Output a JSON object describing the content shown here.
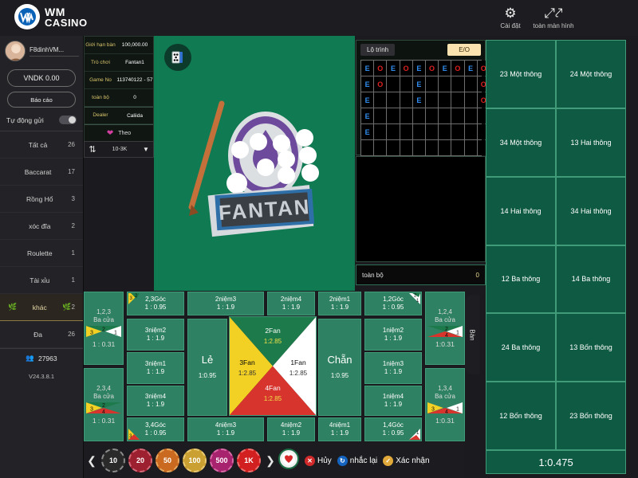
{
  "header": {
    "brand_line1": "WM",
    "brand_line2": "CASINO",
    "settings_label": "Cài đặt",
    "settings_icon": "gear-icon",
    "fullscreen_label": "toàn màn hình",
    "fullscreen_icon": "expand-icon"
  },
  "sidebar": {
    "username": "F8dinhVM...",
    "balance": "VNDK 0.00",
    "report_label": "Báo cáo",
    "auto_send_label": "Tự động gửi",
    "items": [
      {
        "label": "Tất cả",
        "count": "26"
      },
      {
        "label": "Baccarat",
        "count": "17"
      },
      {
        "label": "Rồng Hổ",
        "count": "3"
      },
      {
        "label": "xóc đĩa",
        "count": "2"
      },
      {
        "label": "Roulette",
        "count": "1"
      },
      {
        "label": "Tài xỉu",
        "count": "1"
      },
      {
        "label": "khác",
        "count": "2"
      },
      {
        "label": "Đa",
        "count": "26"
      }
    ],
    "online_count": "27963",
    "version": "V24.3.8.1"
  },
  "info": {
    "rows": [
      {
        "key": "Giới hạn bàn",
        "value": "100,000.00"
      },
      {
        "key": "Trò chơi",
        "value": "Fantan1"
      },
      {
        "key": "Game No",
        "value": "113740122 - 57"
      },
      {
        "key": "toàn bộ",
        "value": "0"
      },
      {
        "key": "Dealer",
        "value": "Caliida"
      }
    ],
    "follow_label": "Theo",
    "heart_icon": "heart-icon"
  },
  "range": {
    "icon": "sort-filter-icon",
    "value": "10-3K",
    "arrow_icon": "chevron-down-icon"
  },
  "video": {
    "card_icon": "playing-card-icon",
    "game_logo": "FANTAN"
  },
  "roadmap": {
    "tab_label": "Lộ trình",
    "eo_label": "E/O",
    "columns": 10,
    "rows": 6,
    "cells": [
      [
        "E",
        "O",
        "E",
        "O",
        "E",
        "O",
        "E",
        "O",
        "E",
        "O"
      ],
      [
        "E",
        "O",
        "",
        "",
        "E",
        "",
        "",
        "",
        "",
        "O"
      ],
      [
        "E",
        "",
        "",
        "",
        "E",
        "",
        "",
        "",
        "",
        "O"
      ],
      [
        "E",
        "",
        "",
        "",
        "",
        "",
        "",
        "",
        "",
        ""
      ],
      [
        "E",
        "",
        "",
        "",
        "",
        "",
        "",
        "",
        "",
        ""
      ],
      [
        "",
        "",
        "",
        "",
        "",
        "",
        "",
        "",
        "",
        ""
      ]
    ]
  },
  "total_bar": {
    "label": "toàn bộ",
    "value": "0"
  },
  "right_panel": {
    "cells": [
      "23 Một thông",
      "24 Một thông",
      "34 Một thông",
      "13 Hai thông",
      "14 Hai thông",
      "34 Hai thông",
      "12 Ba thông",
      "14 Ba thông",
      "24 Ba thông",
      "13 Bốn thông",
      "12 Bốn thông",
      "23 Bốn thông"
    ],
    "odds": "1:0.475"
  },
  "bet_table": {
    "side_left": [
      {
        "numbers": "1,2,3",
        "type": "Ba cửa",
        "odds": "1 : 0.31"
      },
      {
        "numbers": "2,3,4",
        "type": "Ba cửa",
        "odds": "1 : 0.31"
      }
    ],
    "side_right": [
      {
        "numbers": "1,2,4",
        "type": "Ba cửa",
        "odds": "1:0.31"
      },
      {
        "numbers": "1,3,4",
        "type": "Ba cửa",
        "odds": "1:0.31"
      }
    ],
    "corner_top_left": {
      "name": "2,3Góc",
      "odds": "1 : 0.95"
    },
    "corner_bot_left": {
      "name": "3,4Góc",
      "odds": "1 : 0.95"
    },
    "corner_top_right": {
      "name": "1,2Góc",
      "odds": "1 : 0.95"
    },
    "corner_bot_right": {
      "name": "1,4Góc",
      "odds": "1 : 0.95"
    },
    "col_left": [
      {
        "name": "3niệm2",
        "odds": "1 : 1.9"
      },
      {
        "name": "3niệm1",
        "odds": "1 : 1.9"
      },
      {
        "name": "3niệm4",
        "odds": "1 : 1.9"
      }
    ],
    "col_right": [
      {
        "name": "1niệm2",
        "odds": "1 : 1.9"
      },
      {
        "name": "1niệm3",
        "odds": "1 : 1.9"
      },
      {
        "name": "1niệm4",
        "odds": "1 : 1.9"
      }
    ],
    "top_row": [
      {
        "name": "2niệm3",
        "odds": "1 : 1.9"
      },
      {
        "name": "2niệm4",
        "odds": "1 : 1.9"
      },
      {
        "name": "2niệm1",
        "odds": "1 : 1.9"
      }
    ],
    "bottom_row": [
      {
        "name": "4niệm3",
        "odds": "1 : 1.9"
      },
      {
        "name": "4niệm2",
        "odds": "1 : 1.9"
      },
      {
        "name": "4niệm1",
        "odds": "1 : 1.9"
      }
    ],
    "odd": {
      "name": "Lẻ",
      "odds": "1:0.95"
    },
    "even": {
      "name": "Chẵn",
      "odds": "1:0.95"
    },
    "fans": [
      {
        "name": "2Fan",
        "odds": "1:2.85",
        "color": "#1d7a4a"
      },
      {
        "name": "3Fan",
        "odds": "1:2.85",
        "color": "#f2d024"
      },
      {
        "name": "4Fan",
        "odds": "1:2.85",
        "color": "#d6342c"
      },
      {
        "name": "1Fan",
        "odds": "1:2.85",
        "color": "#ffffff"
      }
    ],
    "ban_tab_label": "Bàn"
  },
  "bottom_bar": {
    "prev_icon": "chevron-left-icon",
    "next_icon": "chevron-right-icon",
    "chips": [
      {
        "label": "10",
        "color": "#2a2a2a",
        "ring": "#8a8a8a"
      },
      {
        "label": "20",
        "color": "#9c2030",
        "ring": "#d66a78"
      },
      {
        "label": "50",
        "color": "#c96a20",
        "ring": "#e9a85e"
      },
      {
        "label": "100",
        "color": "#caa033",
        "ring": "#eccb74"
      },
      {
        "label": "500",
        "color": "#a8236e",
        "ring": "#d96aa8"
      },
      {
        "label": "1K",
        "color": "#d22020",
        "ring": "#f07070"
      }
    ],
    "heart_chip_icon": "heart-chip-icon",
    "cancel": {
      "label": "Hủy",
      "icon": "close-circle-icon",
      "color": "#d22a2a"
    },
    "repeat": {
      "label": "nhắc lại",
      "icon": "refresh-circle-icon",
      "color": "#1565c0"
    },
    "confirm": {
      "label": "Xác nhận",
      "icon": "check-circle-icon",
      "color": "#e0a93a"
    }
  }
}
